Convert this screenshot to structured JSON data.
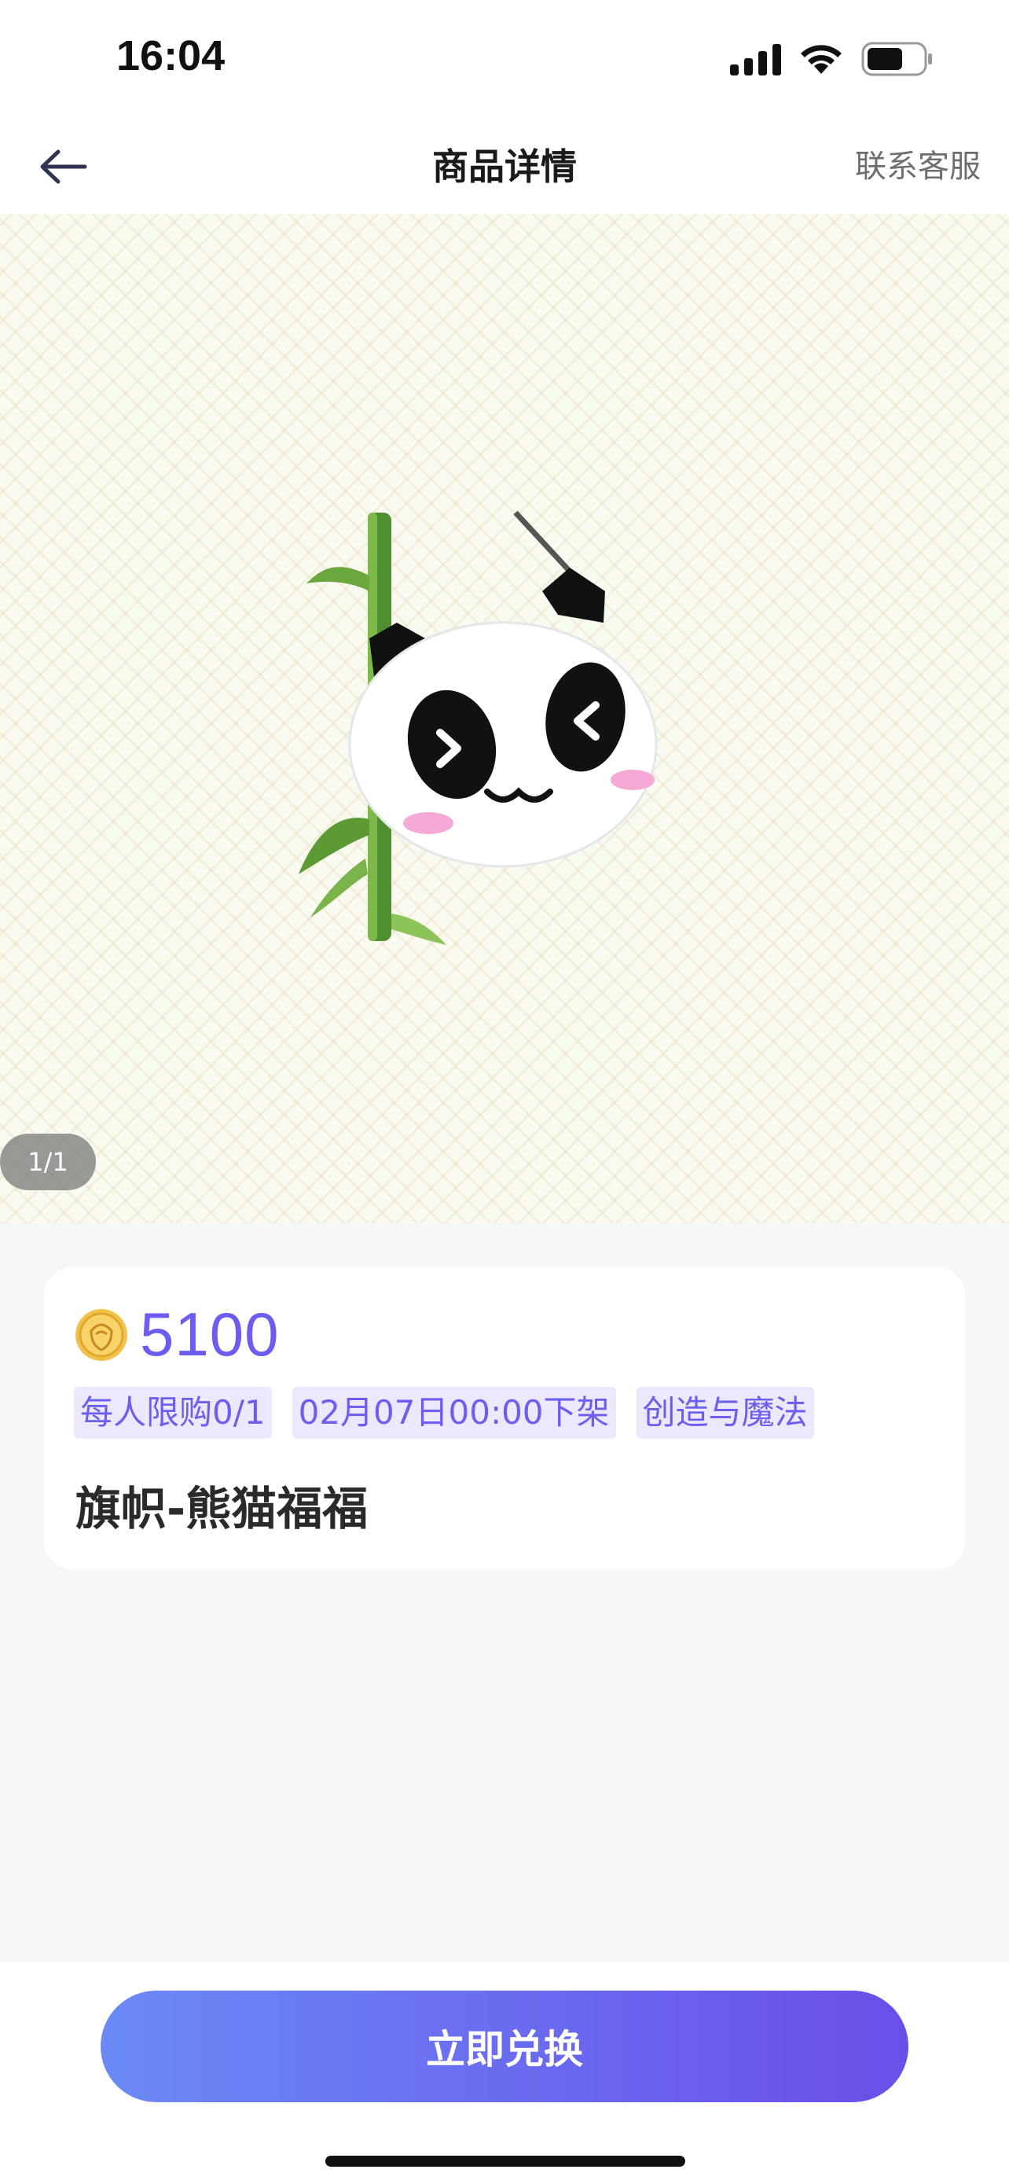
{
  "status_bar": {
    "time": "16:04",
    "icons": [
      "signal-icon",
      "wifi-icon",
      "battery-icon"
    ]
  },
  "nav": {
    "back_icon": "arrow-left-icon",
    "title": "商品详情",
    "contact": "联系客服"
  },
  "gallery": {
    "counter": "1/1",
    "image": "panda-flag-image"
  },
  "product": {
    "coin_icon": "coin-icon",
    "price": "5100",
    "tags": [
      "每人限购0/1",
      "02月07日00:00下架",
      "创造与魔法"
    ],
    "name": "旗帜-熊猫福福"
  },
  "footer": {
    "redeem_label": "立即兑换"
  },
  "colors": {
    "accent": "#6d5cf0",
    "tag_bg": "#ece8fd",
    "button_start": "#6b8af5",
    "button_end": "#6a4ee8"
  }
}
